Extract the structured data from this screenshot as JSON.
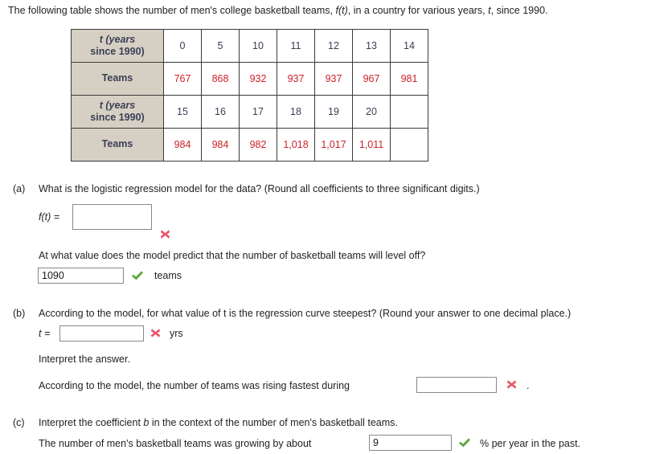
{
  "intro": {
    "part1": "The following table shows the number of men's college basketball teams, ",
    "ft": "f(t)",
    "part2": ", in a country for various years, ",
    "t": "t",
    "part3": ", since 1990."
  },
  "table": {
    "row_header_t": "t (years since 1990)",
    "row_header_t_line1": "t (years",
    "row_header_t_line2": "since 1990)",
    "row_header_teams": "Teams",
    "block1": {
      "t": [
        "0",
        "5",
        "10",
        "11",
        "12",
        "13",
        "14"
      ],
      "teams": [
        "767",
        "868",
        "932",
        "937",
        "937",
        "967",
        "981"
      ]
    },
    "block2": {
      "t": [
        "15",
        "16",
        "17",
        "18",
        "19",
        "20",
        ""
      ],
      "teams": [
        "984",
        "984",
        "982",
        "1,018",
        "1,017",
        "1,011",
        ""
      ]
    }
  },
  "parts": {
    "a": {
      "label": "(a)",
      "question": "What is the logistic regression model for the data? (Round all coefficients to three significant digits.)",
      "ft_label": "f(t) =",
      "ft_value": "",
      "ft_status": "wrong",
      "levelq": "At what value does the model predict that the number of basketball teams will level off?",
      "level_value": "1090",
      "level_status": "right",
      "level_unit": "teams"
    },
    "b": {
      "label": "(b)",
      "question": "According to the model, for what value of t is the regression curve steepest? (Round your answer to one decimal place.)",
      "t_label": "t =",
      "t_value": "",
      "t_status": "wrong",
      "t_unit": "yrs",
      "interpret_heading": "Interpret the answer.",
      "interpret_pre": "According to the model, the number of teams was rising fastest during",
      "interpret_value": "",
      "interpret_status": "wrong",
      "interpret_post": "."
    },
    "c": {
      "label": "(c)",
      "question_pre": "Interpret the coefficient ",
      "question_var": "b",
      "question_post": " in the context of the number of men's basketball teams.",
      "growth_pre": "The number of men's basketball teams was growing by about",
      "growth_value": "9",
      "growth_status": "right",
      "growth_post": "% per year in the past."
    }
  },
  "colors": {
    "wrong": "#e8546a",
    "right": "#5aa83c",
    "table_header_bg": "#d6d0c4",
    "teams_text": "#cc2229",
    "t_text": "#3a3f54"
  }
}
